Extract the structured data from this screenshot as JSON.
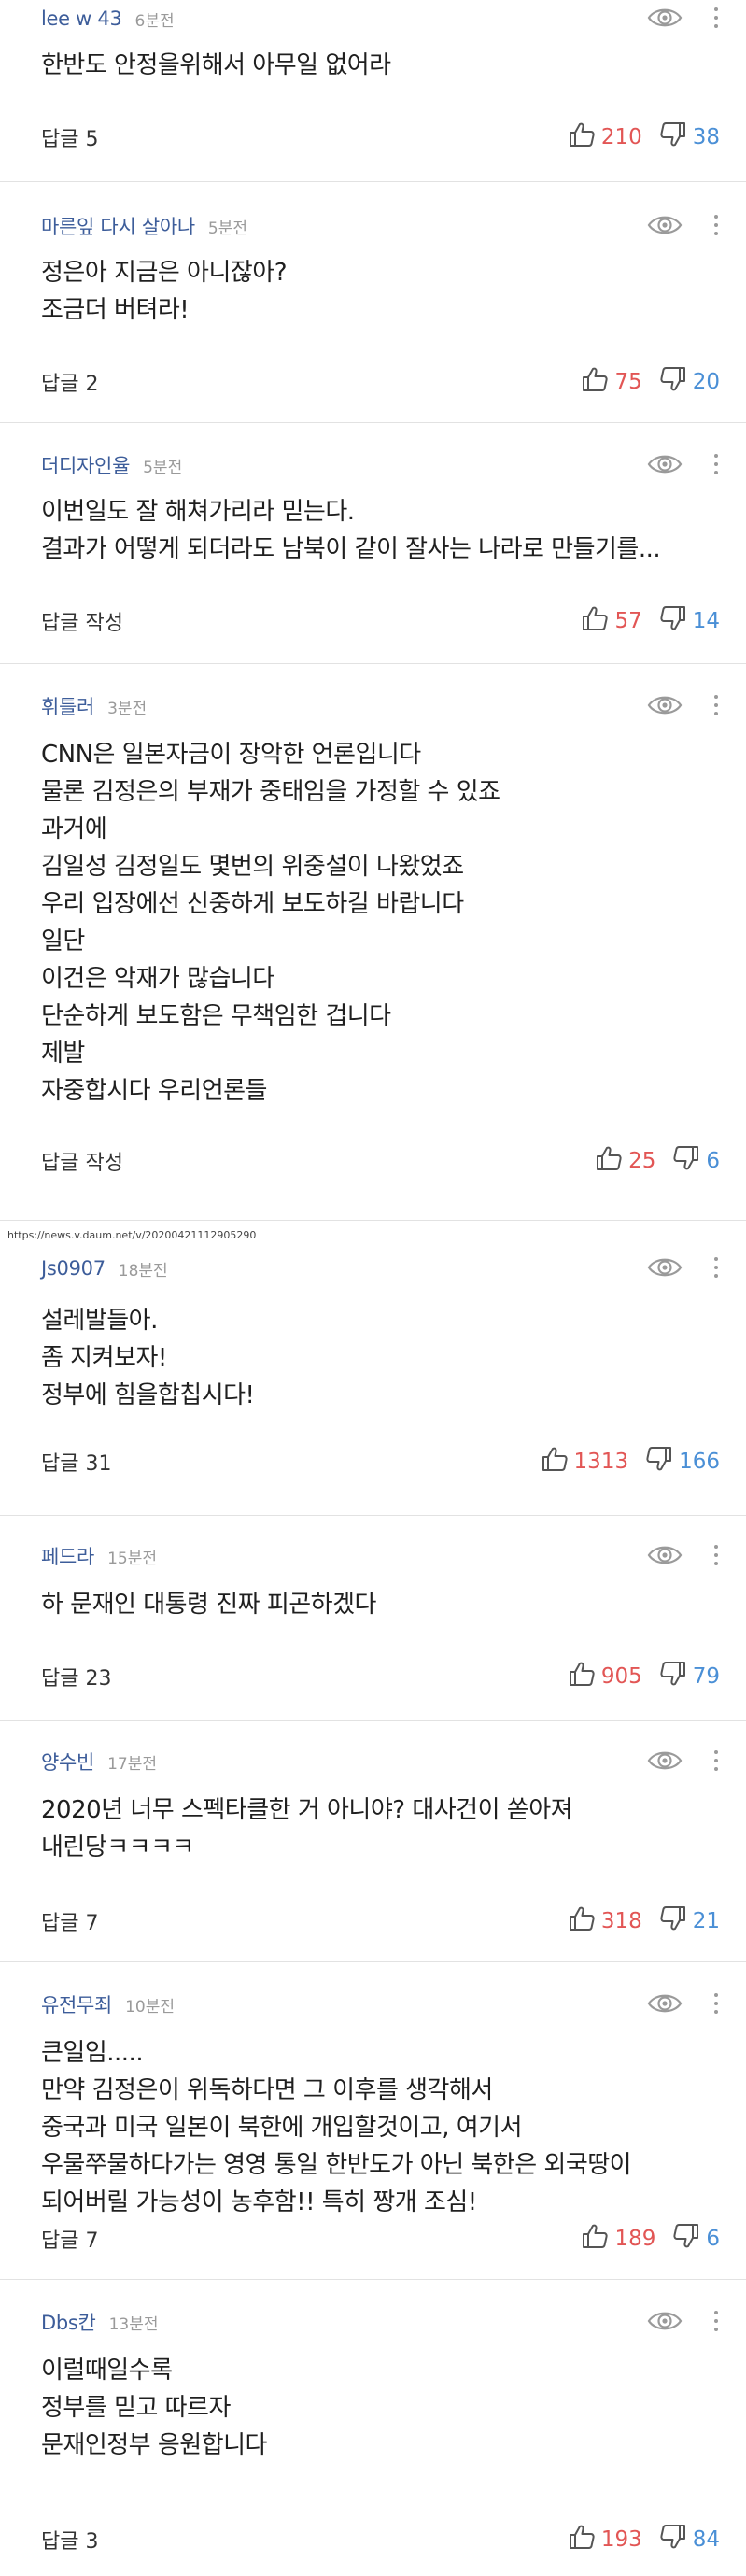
{
  "url_line": "https://news.v.daum.net/v/20200421112905290",
  "comments": [
    {
      "user": "lee w 43",
      "time": "6분전",
      "lines": [
        "한반도 안정을위해서 아무일 없어라"
      ],
      "reply": "답글 5",
      "up": "210",
      "down": "38"
    },
    {
      "user": "마른잎 다시 살아나",
      "time": "5분전",
      "lines": [
        "정은아 지금은 아니잖아?",
        "조금더 버텨라!"
      ],
      "reply": "답글 2",
      "up": "75",
      "down": "20"
    },
    {
      "user": "더디자인율",
      "time": "5분전",
      "lines": [
        "이번일도 잘 해쳐가리라 믿는다.",
        "결과가 어떻게 되더라도 남북이 같이 잘사는 나라로 만들기를..."
      ],
      "reply": "답글 작성",
      "up": "57",
      "down": "14"
    },
    {
      "user": "휘틀러",
      "time": "3분전",
      "lines": [
        "CNN은 일본자금이 장악한 언론입니다",
        "물론 김정은의 부재가 중태임을 가정할 수 있죠",
        "과거에",
        "김일성 김정일도 몇번의 위중설이 나왔었죠",
        "우리 입장에선 신중하게 보도하길 바랍니다",
        "일단",
        "이건은 악재가 많습니다",
        "단순하게 보도함은 무책임한 겁니다",
        "제발",
        "자중합시다 우리언론들"
      ],
      "reply": "답글 작성",
      "up": "25",
      "down": "6"
    },
    {
      "user": "Js0907",
      "time": "18분전",
      "lines": [
        "설레발들아.",
        "좀 지켜보자!",
        "정부에 힘을합칩시다!"
      ],
      "reply": "답글 31",
      "up": "1313",
      "down": "166"
    },
    {
      "user": "페드라",
      "time": "15분전",
      "lines": [
        "하 문재인 대통령 진짜 피곤하겠다"
      ],
      "reply": "답글 23",
      "up": "905",
      "down": "79"
    },
    {
      "user": "양수빈",
      "time": "17분전",
      "lines": [
        "2020년 너무 스펙타클한 거 아니야? 대사건이 쏟아져",
        "내린당ㅋㅋㅋㅋ"
      ],
      "reply": "답글 7",
      "up": "318",
      "down": "21"
    },
    {
      "user": "유전무죄",
      "time": "10분전",
      "lines": [
        "큰일임.....",
        "만약 김정은이 위독하다면 그 이후를 생각해서",
        "중국과 미국 일본이 북한에 개입할것이고, 여기서",
        "우물쭈물하다가는 영영 통일 한반도가 아닌 북한은 외국땅이",
        "되어버릴 가능성이 농후함!! 특히 짱개 조심!"
      ],
      "reply": "답글 7",
      "up": "189",
      "down": "6"
    },
    {
      "user": "Dbs칸",
      "time": "13분전",
      "lines": [
        "이럴때일수록",
        "정부를 믿고 따르자",
        "문재인정부 응원합니다"
      ],
      "reply": "답글 3",
      "up": "193",
      "down": "84"
    }
  ]
}
